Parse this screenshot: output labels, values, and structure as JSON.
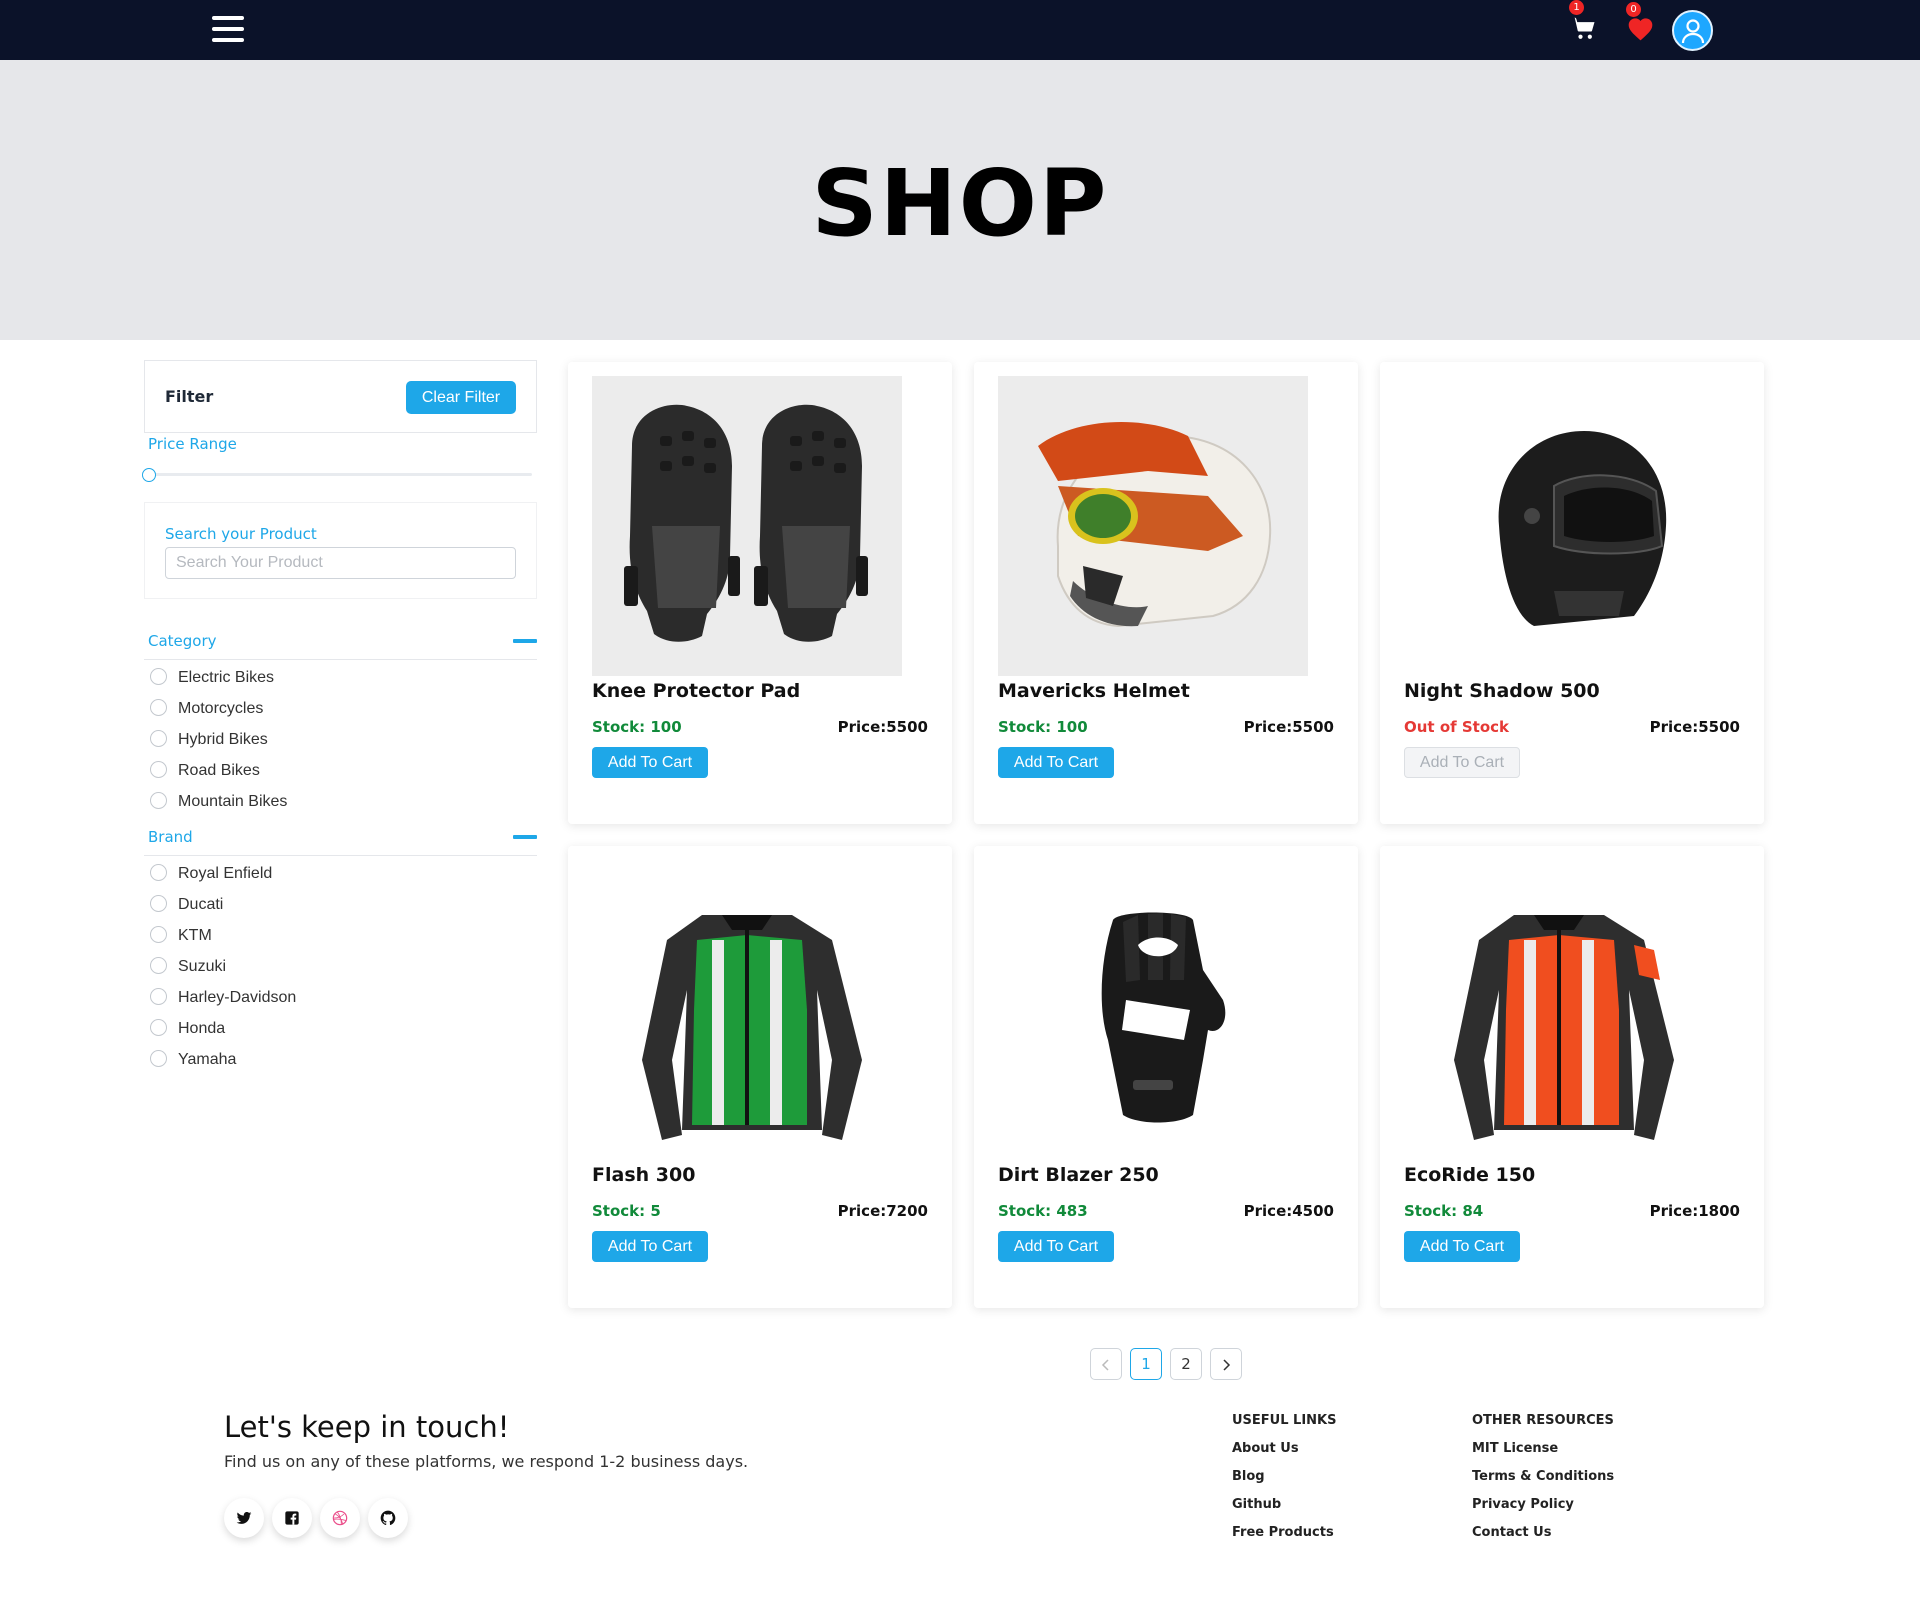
{
  "nav": {
    "cart_count": "1",
    "wishlist_count": "0"
  },
  "hero": {
    "title": "SHOP"
  },
  "sidebar": {
    "filter_title": "Filter",
    "clear_label": "Clear Filter",
    "price_label": "Price Range",
    "price_value_fraction": 0,
    "search_label": "Search your Product",
    "search_placeholder": "Search Your Product",
    "category_title": "Category",
    "categories": [
      "Electric Bikes",
      "Motorcycles",
      "Hybrid Bikes",
      "Road Bikes",
      "Mountain Bikes"
    ],
    "brand_title": "Brand",
    "brands": [
      "Royal Enfield",
      "Ducati",
      "KTM",
      "Suzuki",
      "Harley-Davidson",
      "Honda",
      "Yamaha"
    ]
  },
  "products": [
    {
      "name": "Knee Protector Pad",
      "stock": "Stock: 100",
      "price": "Price:5500",
      "button": "Add To Cart",
      "image": "knee-pad-icon"
    },
    {
      "name": "Mavericks Helmet",
      "stock": "Stock: 100",
      "price": "Price:5500",
      "button": "Add To Cart",
      "image": "mx-helmet-icon"
    },
    {
      "name": "Night Shadow 500",
      "stock": "Out of Stock",
      "price": "Price:5500",
      "button": "Add To Cart",
      "image": "full-face-helmet-icon"
    },
    {
      "name": "Flash 300",
      "stock": "Stock: 5",
      "price": "Price:7200",
      "button": "Add To Cart",
      "image": "green-jacket-icon"
    },
    {
      "name": "Dirt Blazer 250",
      "stock": "Stock: 483",
      "price": "Price:4500",
      "button": "Add To Cart",
      "image": "glove-icon"
    },
    {
      "name": "EcoRide 150",
      "stock": "Stock: 84",
      "price": "Price:1800",
      "button": "Add To Cart",
      "image": "orange-jacket-icon"
    }
  ],
  "pagination": {
    "prev": "<",
    "pages": [
      "1",
      "2"
    ],
    "next": ">",
    "current": "1"
  },
  "footer": {
    "title": "Let's keep in touch!",
    "subtitle": "Find us on any of these platforms, we respond 1-2 business days.",
    "social": [
      "twitter-icon",
      "facebook-icon",
      "dribbble-icon",
      "github-icon"
    ],
    "useful_links_title": "USEFUL LINKS",
    "useful_links": [
      "About Us",
      "Blog",
      "Github",
      "Free Products"
    ],
    "other_resources_title": "OTHER RESOURCES",
    "other_resources": [
      "MIT License",
      "Terms & Conditions",
      "Privacy Policy",
      "Contact Us"
    ]
  },
  "colors": {
    "navbar": "#0b1229",
    "accent": "#1ea7e8",
    "hero_bg": "#e6e7ea",
    "in_stock": "#118a3a",
    "out_of_stock": "#e53935",
    "badge": "#ef2525"
  }
}
